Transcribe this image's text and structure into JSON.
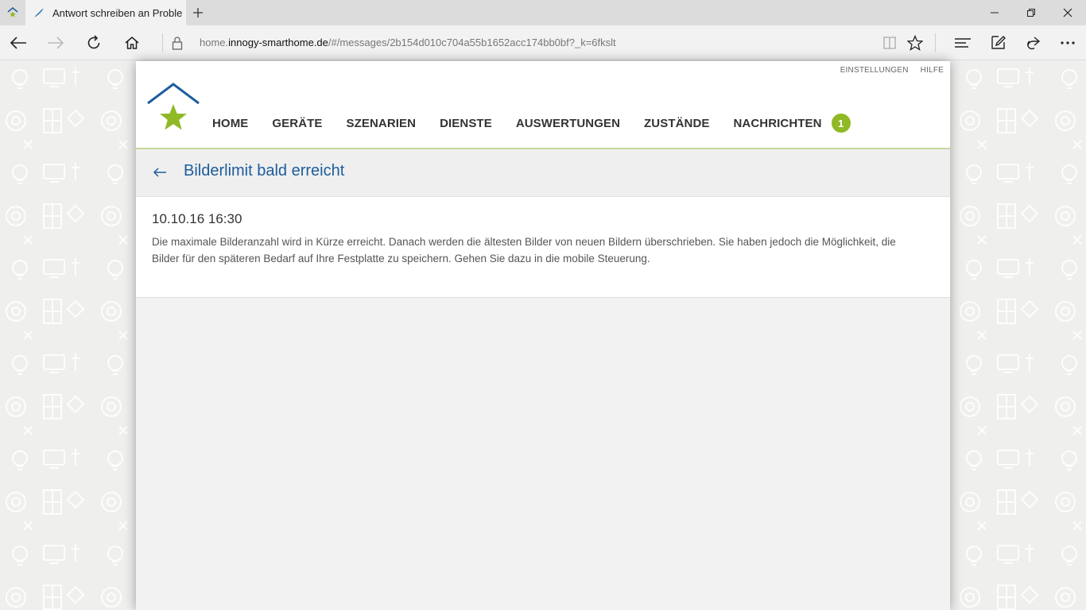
{
  "browser": {
    "tab_title": "Antwort schreiben an Proble",
    "url_prefix": "home.",
    "url_domain": "innogy-smarthome.de",
    "url_path": "/#/messages/2b154d010c704a55b1652acc174bb0bf?_k=6fkslt"
  },
  "icons": {
    "tab_favicon": "house-star-icon",
    "tab_page": "feather-icon",
    "new_tab": "plus-icon",
    "minimize": "minimize-icon",
    "restore": "restore-icon",
    "close": "close-icon",
    "back": "back-arrow-icon",
    "forward": "forward-arrow-icon",
    "refresh": "refresh-icon",
    "home": "home-icon",
    "lock": "lock-icon",
    "reading_view": "book-icon",
    "favorite": "star-icon",
    "hub": "hub-icon",
    "notes": "pen-icon",
    "share": "share-icon",
    "more": "ellipsis-icon"
  },
  "app": {
    "top_links": [
      "EINSTELLUNGEN",
      "HILFE"
    ],
    "nav": [
      "HOME",
      "GERÄTE",
      "SZENARIEN",
      "DIENSTE",
      "AUSWERTUNGEN",
      "ZUSTÄNDE",
      "NACHRICHTEN"
    ],
    "nav_badge": "1",
    "colors": {
      "brand_blue": "#1d5d9c",
      "brand_green": "#8fb925"
    }
  },
  "message": {
    "title": "Bilderlimit bald erreicht",
    "date": "10.10.16 16:30",
    "body": "Die maximale Bilderanzahl wird in Kürze erreicht. Danach werden die ältesten Bilder von neuen Bildern überschrieben. Sie haben jedoch die Möglichkeit, die Bilder für den späteren Bedarf auf Ihre Festplatte zu speichern. Gehen Sie dazu in die mobile Steuerung."
  }
}
